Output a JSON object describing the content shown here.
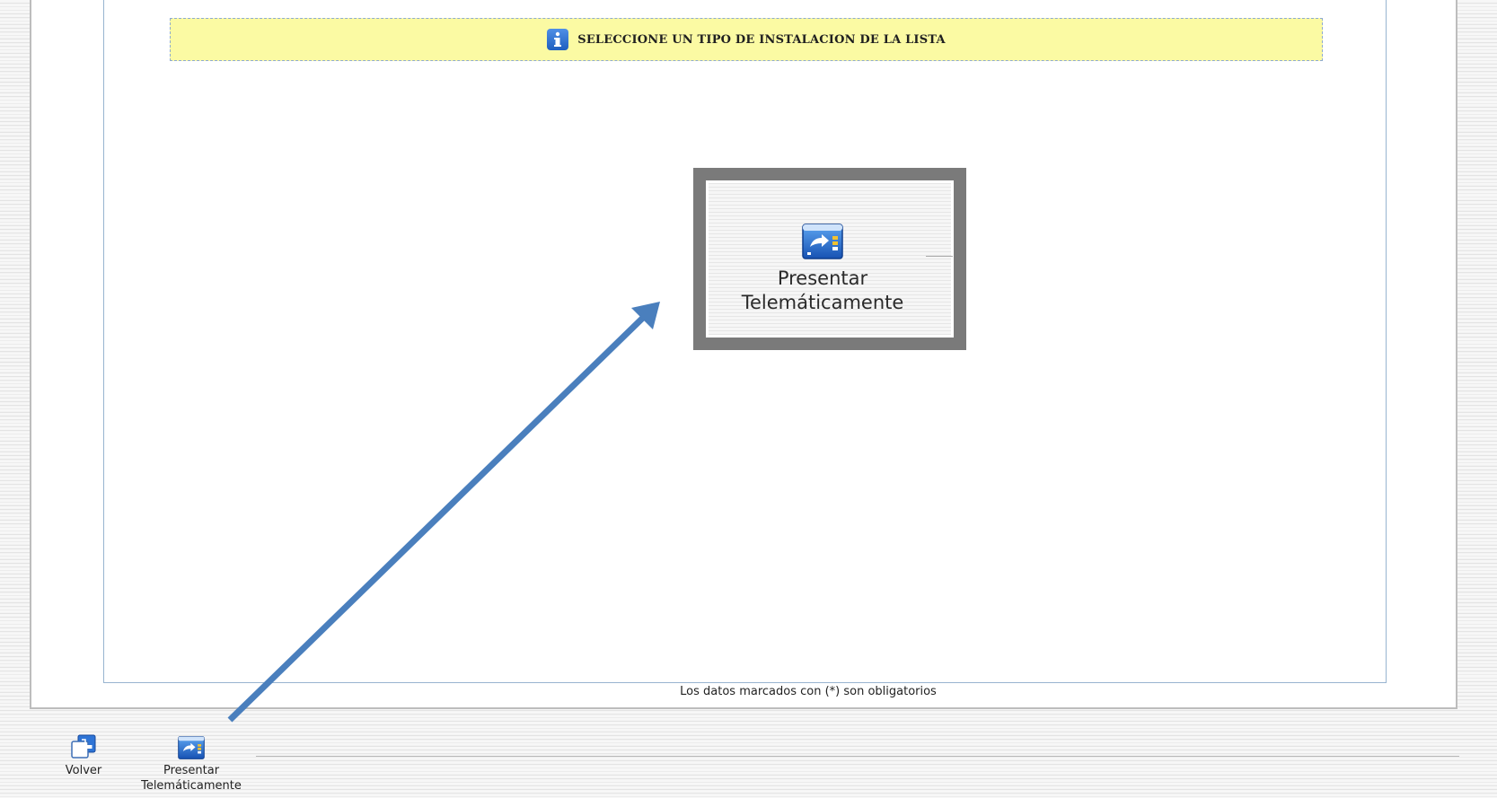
{
  "banner": {
    "text": "SELECCIONE UN TIPO DE INSTALACION DE LA LISTA",
    "icon": "info-icon"
  },
  "zoom_callout": {
    "icon": "present-telematic-icon",
    "label_line1": "Presentar",
    "label_line2": "Telemáticamente"
  },
  "footer": {
    "required_note": "Los datos marcados con (*) son obligatorios"
  },
  "toolbar": {
    "back_label": "Volver",
    "back_icon": "back-arrow-icon",
    "present_label_line1": "Presentar",
    "present_label_line2": "Telemáticamente",
    "present_icon": "present-telematic-icon"
  },
  "colors": {
    "banner_bg": "#fbfaa3",
    "banner_border": "#8eaad0",
    "annotation_arrow": "#4a7fbd",
    "icon_blue": "#1f5fbf"
  }
}
